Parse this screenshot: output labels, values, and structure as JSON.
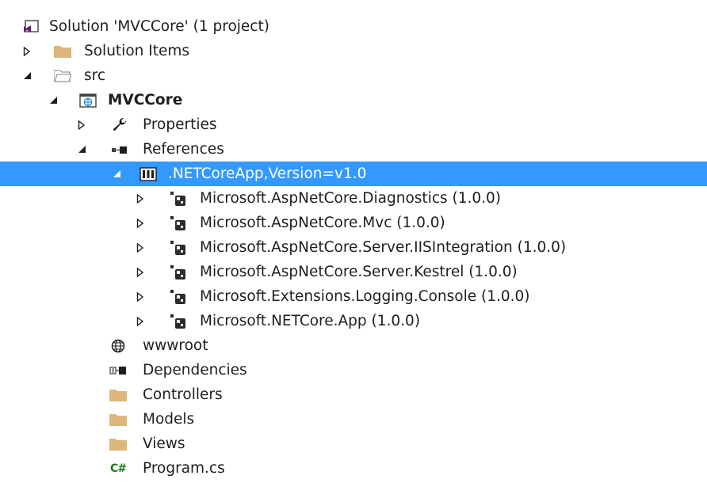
{
  "tree": {
    "rows": [
      {
        "label": "Solution 'MVCCore' (1 project)",
        "icon": "vs-solution-icon"
      },
      {
        "label": "Solution Items",
        "icon": "folder-icon",
        "expand": "collapsed"
      },
      {
        "label": "src",
        "icon": "folder-open-icon",
        "expand": "expanded"
      },
      {
        "label": "MVCCore",
        "icon": "web-project-icon",
        "expand": "expanded"
      },
      {
        "label": "Properties",
        "icon": "wrench-icon",
        "expand": "collapsed"
      },
      {
        "label": "References",
        "icon": "references-icon",
        "expand": "expanded"
      },
      {
        "label": ".NETCoreApp,Version=v1.0",
        "icon": "framework-icon",
        "expand": "expanded",
        "selected": true
      },
      {
        "label": "Microsoft.AspNetCore.Diagnostics (1.0.0)",
        "icon": "nuget-package-icon",
        "expand": "collapsed"
      },
      {
        "label": "Microsoft.AspNetCore.Mvc (1.0.0)",
        "icon": "nuget-package-icon",
        "expand": "collapsed"
      },
      {
        "label": "Microsoft.AspNetCore.Server.IISIntegration (1.0.0)",
        "icon": "nuget-package-icon",
        "expand": "collapsed"
      },
      {
        "label": "Microsoft.AspNetCore.Server.Kestrel (1.0.0)",
        "icon": "nuget-package-icon",
        "expand": "collapsed"
      },
      {
        "label": "Microsoft.Extensions.Logging.Console (1.0.0)",
        "icon": "nuget-package-icon",
        "expand": "collapsed"
      },
      {
        "label": "Microsoft.NETCore.App (1.0.0)",
        "icon": "nuget-package-icon",
        "expand": "collapsed"
      },
      {
        "label": "wwwroot",
        "icon": "globe-icon"
      },
      {
        "label": "Dependencies",
        "icon": "dependencies-icon"
      },
      {
        "label": "Controllers",
        "icon": "folder-icon"
      },
      {
        "label": "Models",
        "icon": "folder-icon"
      },
      {
        "label": "Views",
        "icon": "folder-icon"
      },
      {
        "label": "Program.cs",
        "icon": "csharp-file-icon",
        "icon_text": "C#"
      }
    ]
  },
  "colors": {
    "selection": "#3399ff",
    "folder": "#dcb67a",
    "text": "#1e1e1e",
    "vs_purple": "#68217a",
    "package_dark": "#2b2b2b"
  }
}
